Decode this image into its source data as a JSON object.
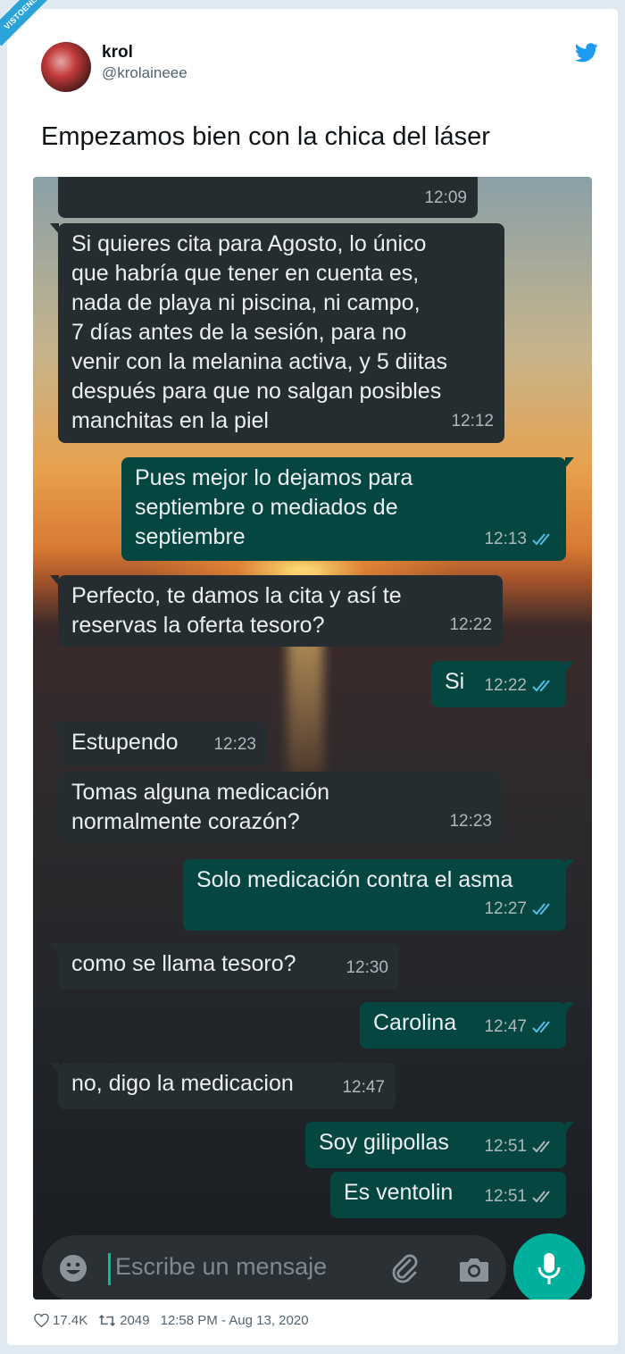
{
  "watermark": "VISTOENLASREDES.com",
  "tweet": {
    "name": "krol",
    "handle": "@krolaineee",
    "text": "Empezamos bien con la chica del láser",
    "likes": "17.4K",
    "retweets": "2049",
    "timestamp": "12:58 PM - Aug 13, 2020"
  },
  "chat": {
    "partial_time": "12:09",
    "messages": [
      {
        "dir": "in",
        "text": "Si quieres cita para Agosto, lo único\nque habría que tener en cuenta es,\nnada de playa ni piscina, ni campo,\n7 días antes de la sesión, para no\nvenir con la melanina activa, y 5 diitas\ndespués para que no salgan posibles\nmanchitas en la piel",
        "time": "12:12"
      },
      {
        "dir": "out",
        "text": "Pues mejor lo dejamos para\nseptiembre o mediados de\nseptiembre",
        "time": "12:13",
        "ticks": "blue"
      },
      {
        "dir": "in",
        "text": "Perfecto, te damos la cita y así te\nreservas la oferta tesoro?",
        "time": "12:22"
      },
      {
        "dir": "out",
        "text": "Si",
        "time": "12:22",
        "ticks": "blue"
      },
      {
        "dir": "in",
        "text": "Estupendo",
        "time": "12:23"
      },
      {
        "dir": "in",
        "text": "Tomas alguna medicación\nnormalmente corazón?",
        "time": "12:23"
      },
      {
        "dir": "out",
        "text": "Solo medicación contra el asma",
        "time": "12:27",
        "ticks": "blue"
      },
      {
        "dir": "in",
        "text": "como se llama tesoro?",
        "time": "12:30"
      },
      {
        "dir": "out",
        "text": "Carolina",
        "time": "12:47",
        "ticks": "blue"
      },
      {
        "dir": "in",
        "text": "no, digo la medicacion",
        "time": "12:47"
      },
      {
        "dir": "out",
        "text": "Soy gilipollas",
        "time": "12:51",
        "ticks": "grey"
      },
      {
        "dir": "out",
        "text": "Es ventolin",
        "time": "12:51",
        "ticks": "grey"
      }
    ],
    "input_placeholder": "Escribe un mensaje"
  },
  "colors": {
    "incoming": "#262d31",
    "outgoing": "#054740",
    "tick_blue": "#53bdeb",
    "tick_grey": "#aeb7bb",
    "mic": "#00af9c",
    "twitter": "#1d9bf0"
  }
}
